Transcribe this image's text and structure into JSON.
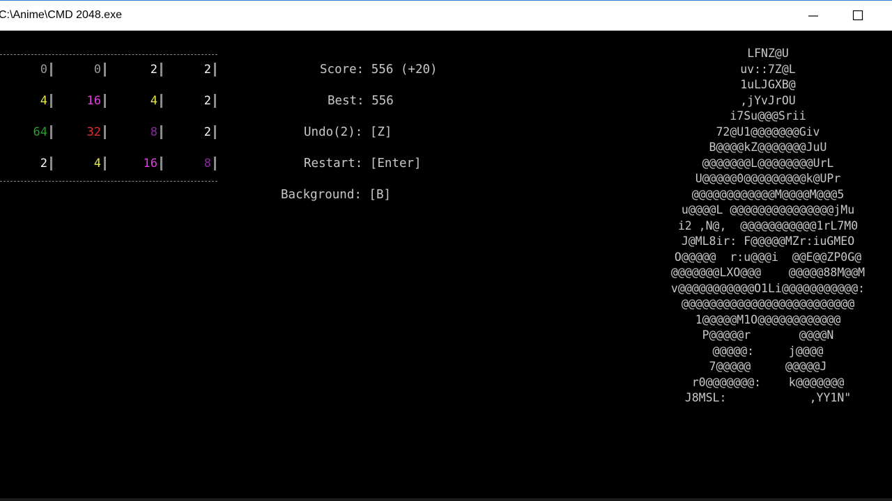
{
  "window": {
    "title": "C:\\Anime\\CMD 2048.exe",
    "minimize_icon": "minimize-icon",
    "maximize_icon": "maximize-icon"
  },
  "board": {
    "rows": [
      [
        {
          "value": "0",
          "color": "#9a9a9a"
        },
        {
          "value": "0",
          "color": "#9a9a9a"
        },
        {
          "value": "2",
          "color": "#ffffff"
        },
        {
          "value": "2",
          "color": "#ffffff"
        }
      ],
      [
        {
          "value": "4",
          "color": "#e6e64a"
        },
        {
          "value": "16",
          "color": "#e03ce0"
        },
        {
          "value": "4",
          "color": "#e6e64a"
        },
        {
          "value": "2",
          "color": "#ffffff"
        }
      ],
      [
        {
          "value": "64",
          "color": "#2e9e2e"
        },
        {
          "value": "32",
          "color": "#e03030"
        },
        {
          "value": "8",
          "color": "#8a2aa0"
        },
        {
          "value": "2",
          "color": "#ffffff"
        }
      ],
      [
        {
          "value": "2",
          "color": "#ffffff"
        },
        {
          "value": "4",
          "color": "#e6e64a"
        },
        {
          "value": "16",
          "color": "#e03ce0"
        },
        {
          "value": "8",
          "color": "#8a2aa0"
        }
      ]
    ]
  },
  "info": {
    "score": "Score: 556 (+20)",
    "best": "Best: 556",
    "undo": "Undo(2): [Z]",
    "restart": "Restart: [Enter]",
    "background": "Background: [B]"
  },
  "ascii_art": [
    "LFNZ@U",
    "uv::7Z@L",
    "1uLJGXB@",
    ",jYvJrOU",
    "i7Su@@@Srii",
    "72@U1@@@@@@@Giv",
    "B@@@@kZ@@@@@@@JuU",
    "@@@@@@@L@@@@@@@@UrL",
    "U@@@@@0@@@@@@@@@k@UPr",
    "@@@@@@@@@@@@M@@@@M@@@5",
    "u@@@@L @@@@@@@@@@@@@@@jMu",
    "i2 ,N@,  @@@@@@@@@@@1rL7M0",
    "J@ML8ir: F@@@@@MZr:iuGMEO",
    "O@@@@@  r:u@@@i  @@E@@ZP0G@",
    "@@@@@@@LXO@@@    @@@@@88M@@M",
    "v@@@@@@@@@@@O1Li@@@@@@@@@@@:",
    "@@@@@@@@@@@@@@@@@@@@@@@@@",
    "1@@@@@M1O@@@@@@@@@@@@",
    "P@@@@@r       @@@@N",
    "@@@@@:     j@@@@",
    "7@@@@@     @@@@@J",
    "r0@@@@@@@:    k@@@@@@@",
    "J8MSL:            ,YY1N\""
  ]
}
